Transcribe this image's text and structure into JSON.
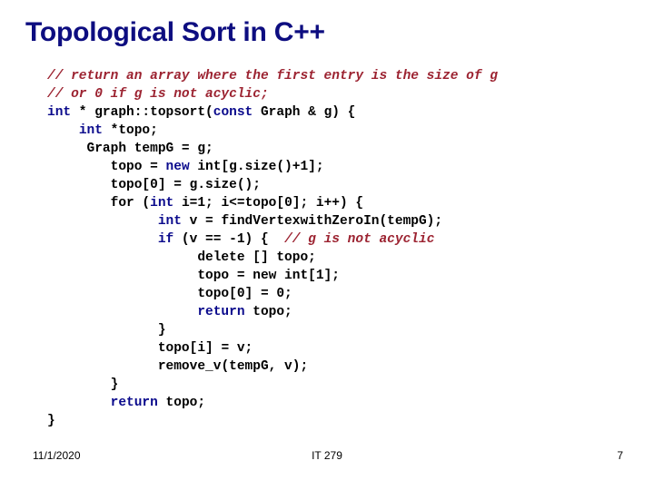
{
  "slide": {
    "title": "Topological Sort in C++",
    "title_color": "#0d0d80",
    "background_color": "#ffffff"
  },
  "code": {
    "keyword_color": "#0a0a8c",
    "comment_color": "#9c2331",
    "plain_color": "#000000",
    "language": "C++",
    "lines": [
      {
        "indent": 0,
        "tokens": [
          {
            "t": "comment",
            "v": "// return an array where the first entry is the size of g"
          }
        ]
      },
      {
        "indent": 0,
        "tokens": [
          {
            "t": "comment",
            "v": "// or 0 if g is not acyclic;"
          }
        ]
      },
      {
        "indent": 0,
        "tokens": [
          {
            "t": "kw",
            "v": "int"
          },
          {
            "t": "plain",
            "v": " * graph::topsort("
          },
          {
            "t": "kw",
            "v": "const"
          },
          {
            "t": "plain",
            "v": " Graph & g) {"
          }
        ]
      },
      {
        "indent": 4,
        "tokens": [
          {
            "t": "kw",
            "v": "int"
          },
          {
            "t": "plain",
            "v": " *topo;"
          }
        ]
      },
      {
        "indent": 5,
        "tokens": [
          {
            "t": "plain",
            "v": "Graph tempG = g;"
          }
        ]
      },
      {
        "indent": 8,
        "tokens": [
          {
            "t": "plain",
            "v": "topo = "
          },
          {
            "t": "kw",
            "v": "new"
          },
          {
            "t": "plain",
            "v": " int[g.size()+1];"
          }
        ]
      },
      {
        "indent": 8,
        "tokens": [
          {
            "t": "plain",
            "v": "topo[0] = g.size();"
          }
        ]
      },
      {
        "indent": 8,
        "tokens": [
          {
            "t": "plain",
            "v": "for ("
          },
          {
            "t": "kw",
            "v": "int"
          },
          {
            "t": "plain",
            "v": " i=1; i<=topo[0]; i++) {"
          }
        ]
      },
      {
        "indent": 14,
        "tokens": [
          {
            "t": "kw",
            "v": "int"
          },
          {
            "t": "plain",
            "v": " v = findVertexwithZeroIn(tempG);"
          }
        ]
      },
      {
        "indent": 14,
        "tokens": [
          {
            "t": "kw",
            "v": "if"
          },
          {
            "t": "plain",
            "v": " (v == -1) {  "
          },
          {
            "t": "comment",
            "v": "// g is not acyclic"
          }
        ]
      },
      {
        "indent": 19,
        "tokens": [
          {
            "t": "plain",
            "v": "delete [] topo;"
          }
        ]
      },
      {
        "indent": 19,
        "tokens": [
          {
            "t": "plain",
            "v": "topo = new int[1];"
          }
        ]
      },
      {
        "indent": 19,
        "tokens": [
          {
            "t": "plain",
            "v": "topo[0] = 0;"
          }
        ]
      },
      {
        "indent": 19,
        "tokens": [
          {
            "t": "kw",
            "v": "return"
          },
          {
            "t": "plain",
            "v": " topo;"
          }
        ]
      },
      {
        "indent": 14,
        "tokens": [
          {
            "t": "plain",
            "v": "}"
          }
        ]
      },
      {
        "indent": 14,
        "tokens": [
          {
            "t": "plain",
            "v": "topo[i] = v;"
          }
        ]
      },
      {
        "indent": 14,
        "tokens": [
          {
            "t": "plain",
            "v": "remove_v(tempG, v);"
          }
        ]
      },
      {
        "indent": 8,
        "tokens": [
          {
            "t": "plain",
            "v": "}"
          }
        ]
      },
      {
        "indent": 8,
        "tokens": [
          {
            "t": "kw",
            "v": "return"
          },
          {
            "t": "plain",
            "v": " topo;"
          }
        ]
      },
      {
        "indent": 0,
        "tokens": [
          {
            "t": "plain",
            "v": "}"
          }
        ]
      }
    ]
  },
  "footer": {
    "date": "11/1/2020",
    "course": "IT 279",
    "page_number": "7"
  }
}
